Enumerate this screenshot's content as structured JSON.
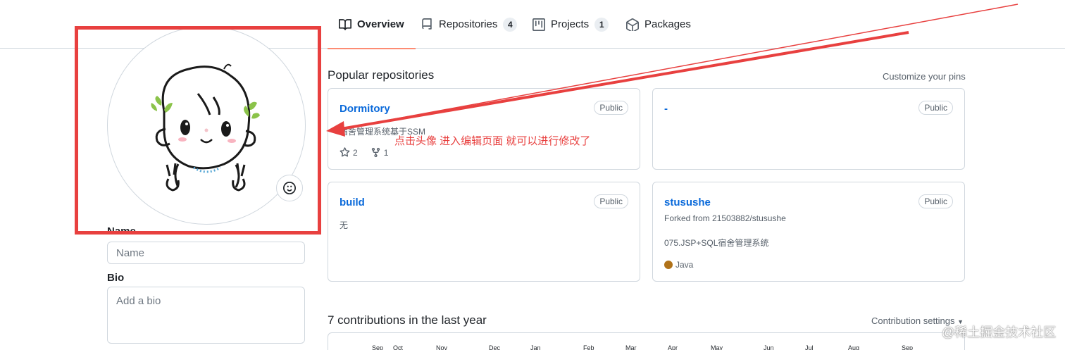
{
  "tabs": [
    {
      "label": "Overview",
      "icon": "book-icon",
      "selected": true
    },
    {
      "label": "Repositories",
      "icon": "repo-icon",
      "count": "4"
    },
    {
      "label": "Projects",
      "icon": "project-icon",
      "count": "1"
    },
    {
      "label": "Packages",
      "icon": "package-icon"
    }
  ],
  "profile": {
    "name_label": "Name",
    "name_placeholder": "Name",
    "bio_label": "Bio",
    "bio_placeholder": "Add a bio"
  },
  "popular": {
    "title": "Popular repositories",
    "customize": "Customize your pins",
    "repos": [
      {
        "name": "Dormitory",
        "visibility": "Public",
        "description": "宿舍管理系统基于SSM",
        "stars": "2",
        "forks": "1"
      },
      {
        "name": "-",
        "visibility": "Public"
      },
      {
        "name": "build",
        "visibility": "Public",
        "description": "无"
      },
      {
        "name": "stusushe",
        "visibility": "Public",
        "forked_from": "Forked from 21503882/stusushe",
        "description": "075.JSP+SQL宿舍管理系统",
        "language": "Java",
        "language_color": "#b07219"
      }
    ]
  },
  "annotation": {
    "text": "点击头像 进入编辑页面 就可以进行修改了",
    "color": "#e8403f"
  },
  "contributions": {
    "title": "7 contributions in the last year",
    "settings": "Contribution settings",
    "months": [
      "Sep",
      "Oct",
      "Nov",
      "Dec",
      "Jan",
      "Feb",
      "Mar",
      "Apr",
      "May",
      "Jun",
      "Jul",
      "Aug",
      "Sep"
    ]
  },
  "watermark": "@稀土掘金技术社区",
  "colors": {
    "accent": "#0969da",
    "tab_underline": "#fd8c73",
    "annotation": "#e8403f"
  }
}
